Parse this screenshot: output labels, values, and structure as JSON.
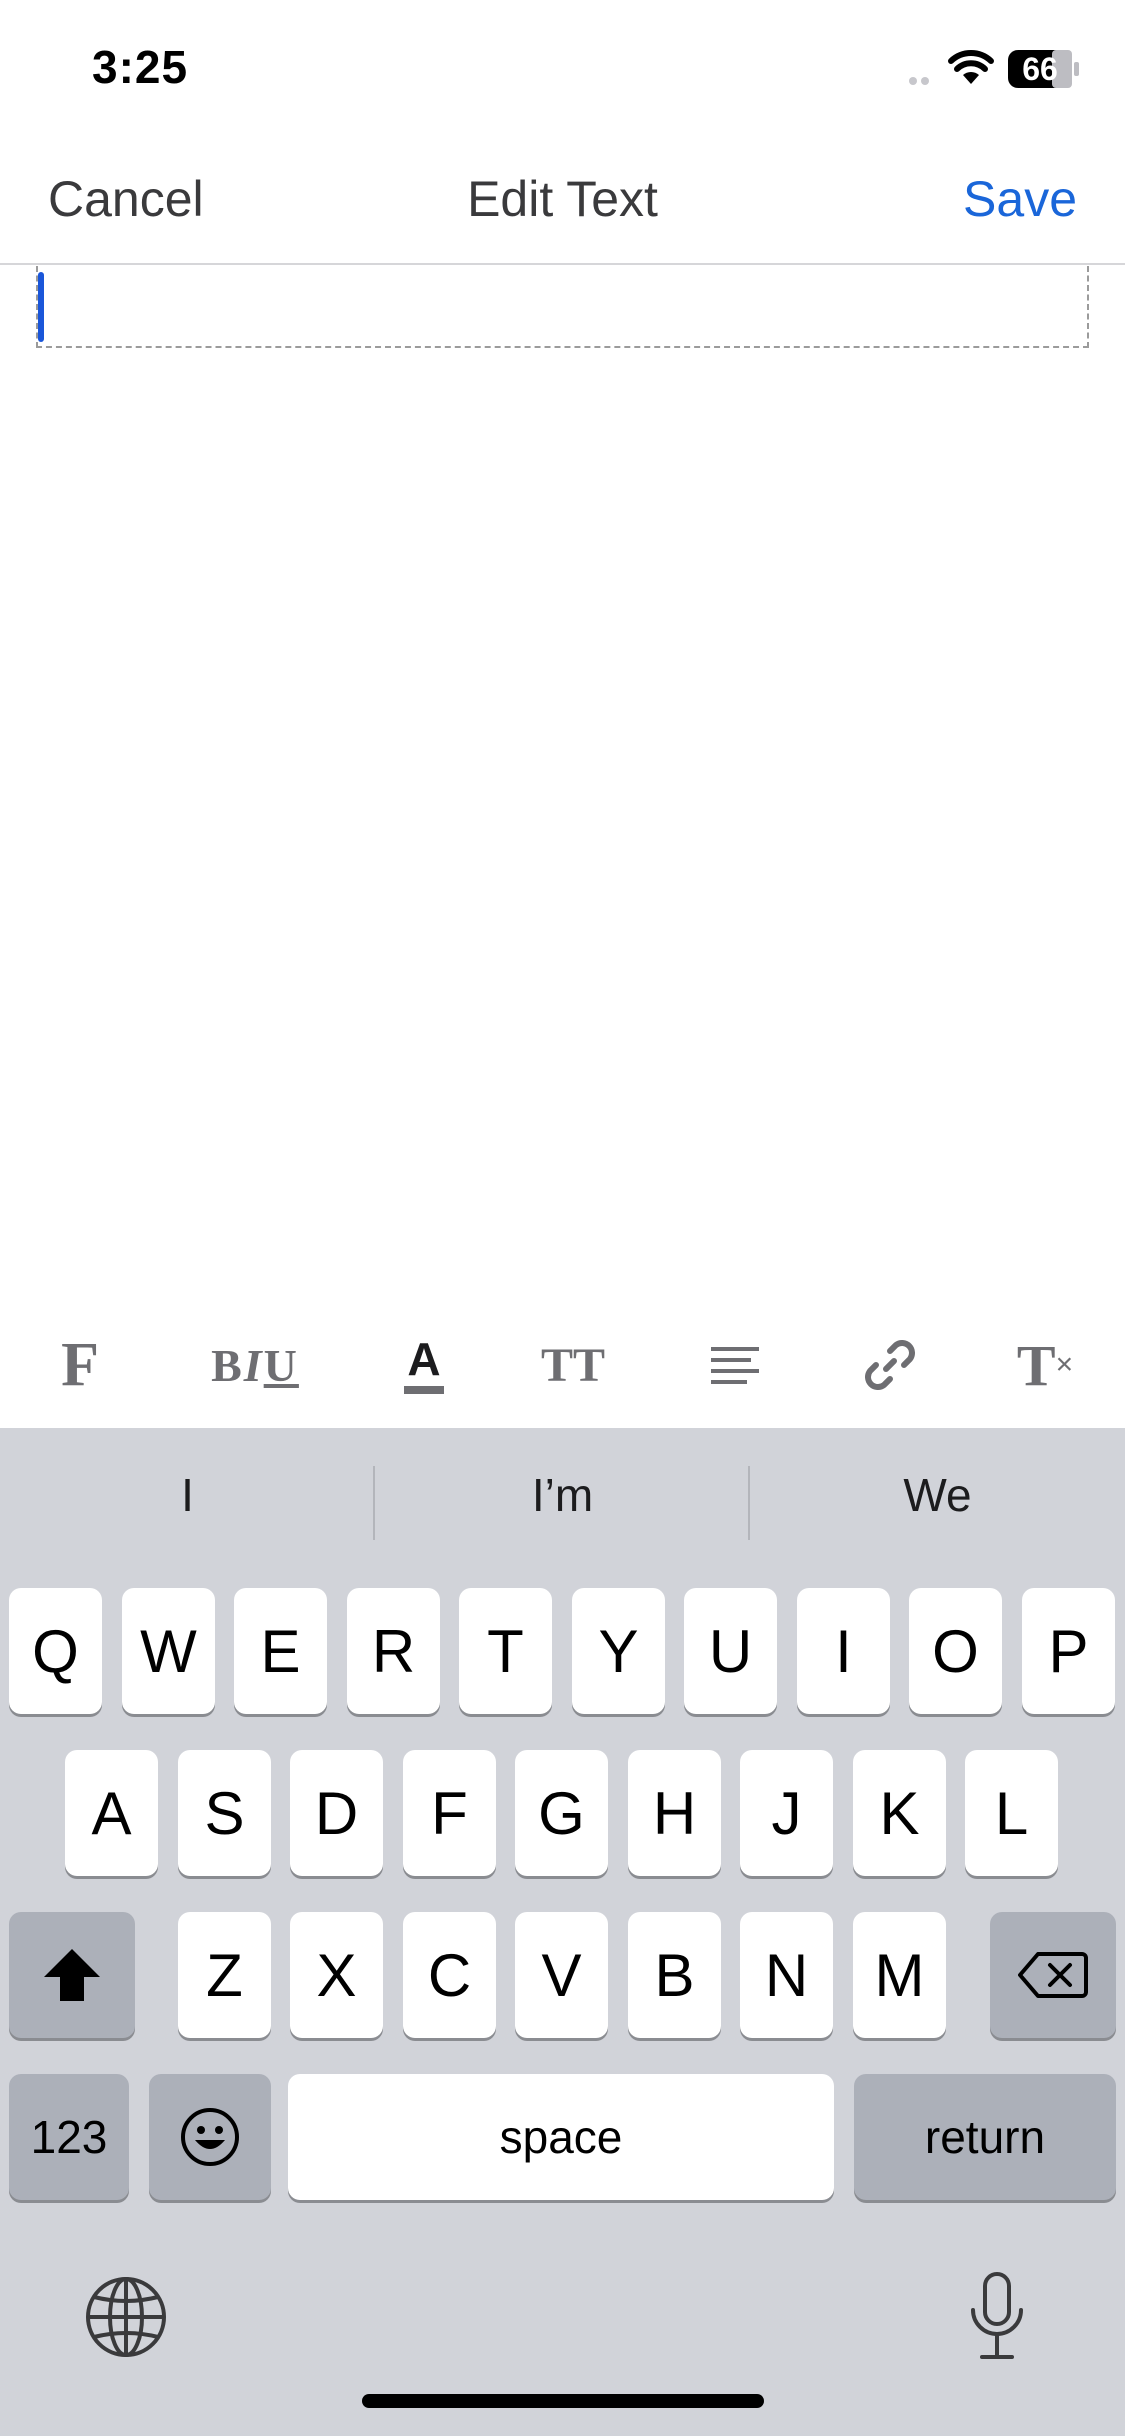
{
  "status_bar": {
    "time": "3:25",
    "battery": "66",
    "icons": [
      "signal-icon",
      "wifi-icon",
      "battery-icon"
    ]
  },
  "nav": {
    "cancel_label": "Cancel",
    "title": "Edit Text",
    "save_label": "Save"
  },
  "editor": {
    "value": ""
  },
  "toolbar": {
    "font_label": "F",
    "bold": "B",
    "italic": "I",
    "underline": "U",
    "color_letter": "A",
    "size_label": "TT",
    "clear_label": "T",
    "clear_sub": "×",
    "icons": [
      "font-icon",
      "bold-italic-underline-icon",
      "text-color-icon",
      "text-size-icon",
      "align-icon",
      "link-icon",
      "clear-format-icon"
    ]
  },
  "keyboard": {
    "suggestions": [
      "I",
      "I’m",
      "We"
    ],
    "row1": [
      "Q",
      "W",
      "E",
      "R",
      "T",
      "Y",
      "U",
      "I",
      "O",
      "P"
    ],
    "row2": [
      "A",
      "S",
      "D",
      "F",
      "G",
      "H",
      "J",
      "K",
      "L"
    ],
    "row3": [
      "Z",
      "X",
      "C",
      "V",
      "B",
      "N",
      "M"
    ],
    "numbers_label": "123",
    "space_label": "space",
    "return_label": "return",
    "icons": [
      "shift-icon",
      "delete-icon",
      "emoji-icon",
      "globe-icon",
      "microphone-icon"
    ]
  },
  "colors": {
    "accent": "#1a66d9",
    "keyboard_bg": "#d1d3d9",
    "key_dark": "#acb0b9",
    "cursor": "#1a56d9"
  }
}
